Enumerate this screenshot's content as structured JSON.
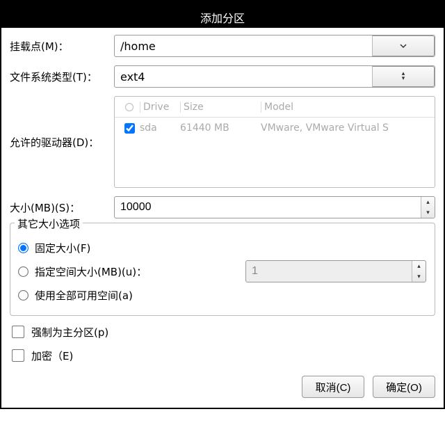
{
  "title": "添加分区",
  "labels": {
    "mount_point": "挂载点(M)：",
    "fs_type": "文件系统类型(T)：",
    "allowed_drives": "允许的驱动器(D)：",
    "size_mb": "大小(MB)(S)："
  },
  "mount_point": {
    "value": "/home"
  },
  "fs_type": {
    "value": "ext4"
  },
  "drives": {
    "headers": {
      "drive": "Drive",
      "size": "Size",
      "model": "Model"
    },
    "rows": [
      {
        "checked": true,
        "drive": "sda",
        "size": "61440 MB",
        "model": "VMware, VMware Virtual S"
      }
    ]
  },
  "size_mb": {
    "value": "10000"
  },
  "size_options": {
    "group_title": "其它大小选项",
    "fixed": "固定大小(F)",
    "up_to": "指定空间大小(MB)(u)：",
    "up_to_value": "1",
    "fill": "使用全部可用空间(a)",
    "selected": "fixed"
  },
  "flags": {
    "primary": "强制为主分区(p)",
    "encrypt": "加密（E)"
  },
  "buttons": {
    "cancel": "取消(C)",
    "ok": "确定(O)"
  }
}
